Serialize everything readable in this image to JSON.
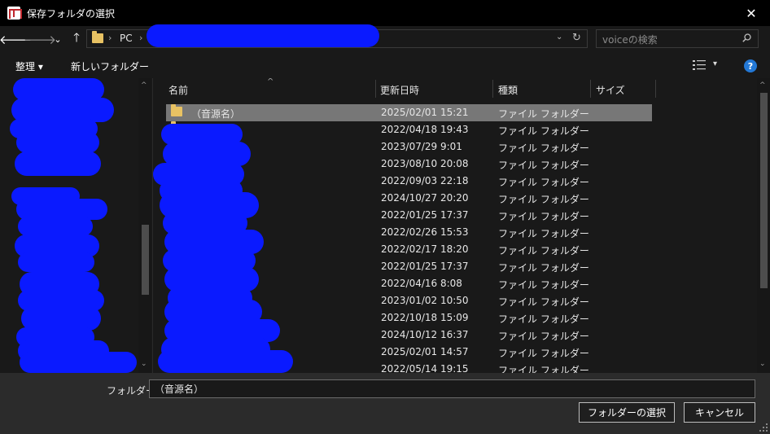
{
  "window": {
    "title": "保存フォルダの選択",
    "close_glyph": "✕"
  },
  "nav": {
    "back_glyph": "🡐",
    "forward_glyph": "🡒",
    "recent_glyph": "⌄",
    "up_glyph": "🡑",
    "breadcrumb": [
      "PC"
    ],
    "separator": "›",
    "dropdown_glyph": "⌄",
    "refresh_glyph": "↻",
    "search_placeholder": "voiceの検索"
  },
  "toolbar": {
    "organize_label": "整理 ▾",
    "new_folder_label": "新しいフォルダー",
    "view_dropdown_glyph": "▾",
    "help_glyph": "?"
  },
  "columns": {
    "name": "名前",
    "modified": "更新日時",
    "type": "種類",
    "size": "サイズ",
    "sort_glyph": "^"
  },
  "files": [
    {
      "name": "（音源名）",
      "modified": "2025/02/01 15:21",
      "type": "ファイル フォルダー",
      "selected": true
    },
    {
      "name": "",
      "modified": "2022/04/18 19:43",
      "type": "ファイル フォルダー"
    },
    {
      "name": "",
      "modified": "2023/07/29 9:01",
      "type": "ファイル フォルダー"
    },
    {
      "name": "",
      "modified": "2023/08/10 20:08",
      "type": "ファイル フォルダー"
    },
    {
      "name": "",
      "modified": "2022/09/03 22:18",
      "type": "ファイル フォルダー"
    },
    {
      "name": "",
      "modified": "2024/10/27 20:20",
      "type": "ファイル フォルダー"
    },
    {
      "name": "",
      "modified": "2022/01/25 17:37",
      "type": "ファイル フォルダー"
    },
    {
      "name": "",
      "modified": "2022/02/26 15:53",
      "type": "ファイル フォルダー"
    },
    {
      "name": "",
      "modified": "2022/02/17 18:20",
      "type": "ファイル フォルダー"
    },
    {
      "name": "",
      "modified": "2022/01/25 17:37",
      "type": "ファイル フォルダー"
    },
    {
      "name": "",
      "modified": "2022/04/16 8:08",
      "type": "ファイル フォルダー"
    },
    {
      "name": "",
      "modified": "2023/01/02 10:50",
      "type": "ファイル フォルダー"
    },
    {
      "name": "",
      "modified": "2022/10/18 15:09",
      "type": "ファイル フォルダー"
    },
    {
      "name": "",
      "modified": "2024/10/12 16:37",
      "type": "ファイル フォルダー"
    },
    {
      "name": "",
      "modified": "2025/02/01 14:57",
      "type": "ファイル フォルダー"
    },
    {
      "name": "",
      "modified": "2022/05/14 19:15",
      "type": "ファイル フォルダー"
    }
  ],
  "footer": {
    "folder_label": "フォルダー:",
    "folder_value": "（音源名）",
    "select_button": "フォルダーの選択",
    "cancel_button": "キャンセル"
  },
  "scroll": {
    "up_glyph": "^",
    "down_glyph": "⌄"
  },
  "colors": {
    "background": "#191919",
    "titlebar": "#000000",
    "selected_row": "#777777",
    "folder_icon": "#e8c263",
    "help": "#2378d6",
    "redaction": "#0a1aff"
  }
}
